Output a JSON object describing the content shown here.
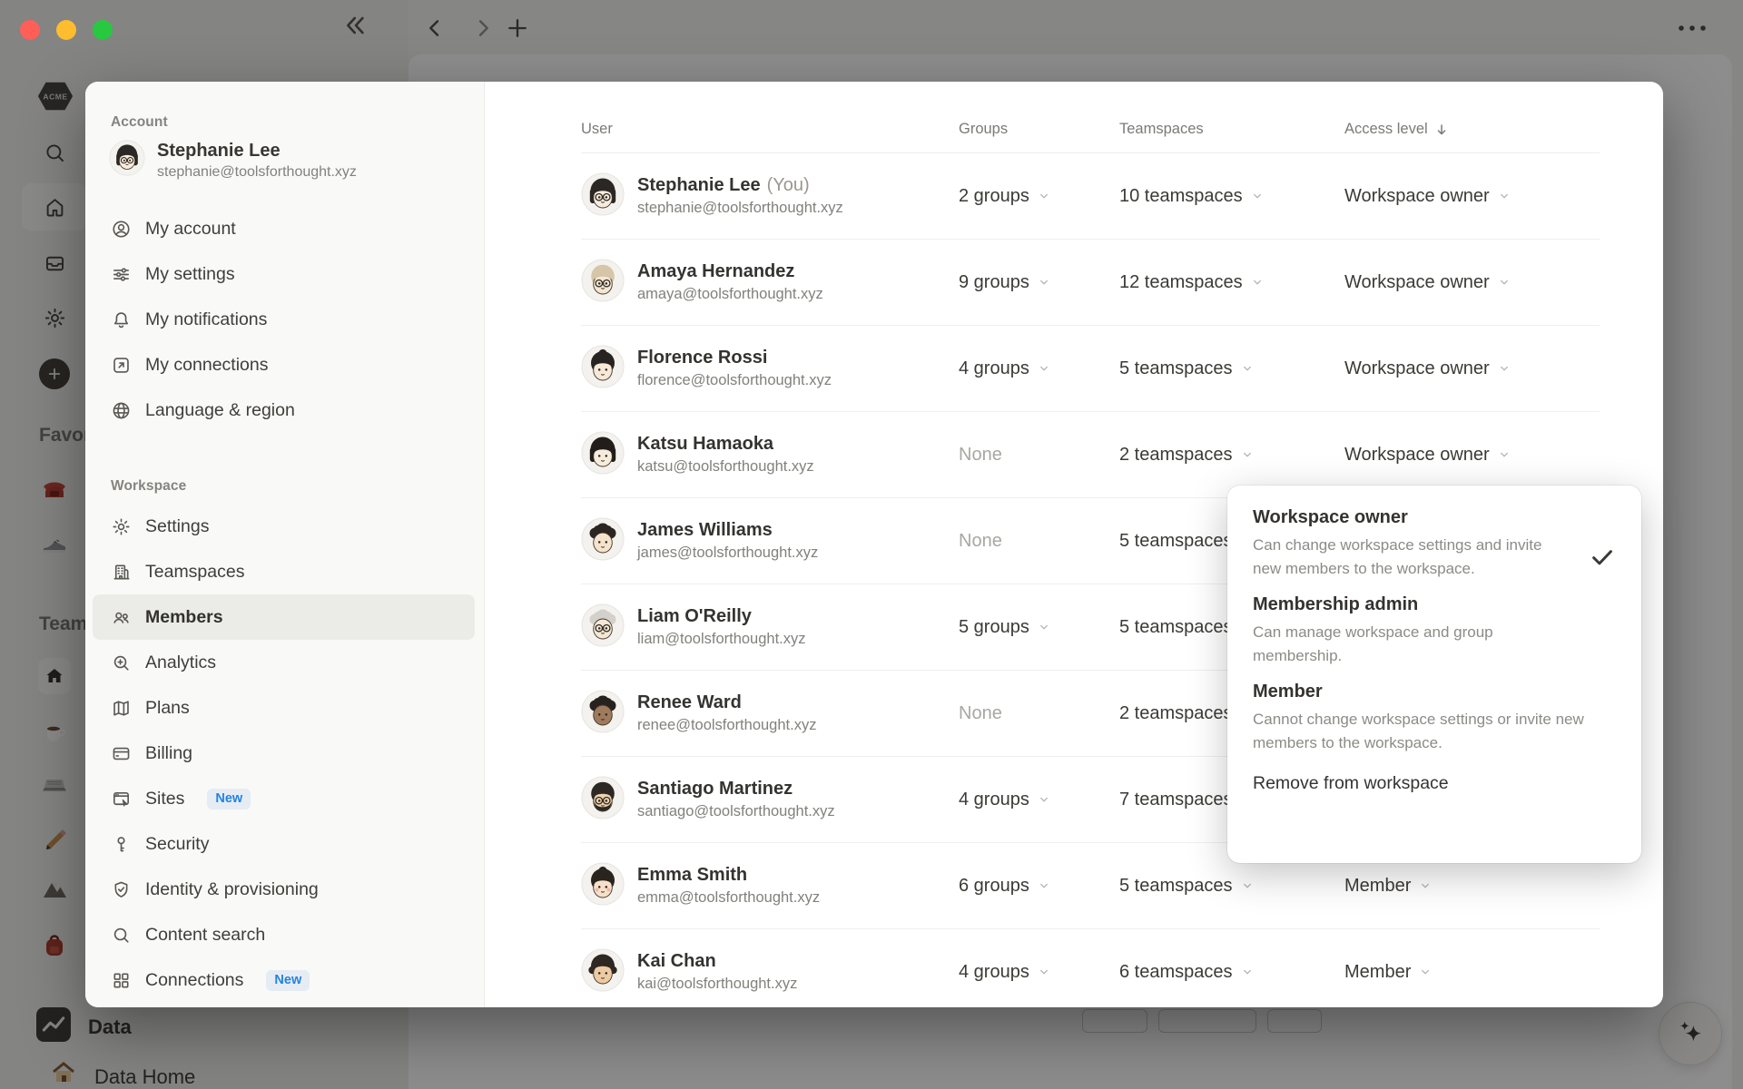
{
  "window": {
    "traffic_lights": {
      "close": "#ff5f57",
      "minimize": "#febc2e",
      "zoom": "#28c840"
    },
    "topbar_icons": [
      "collapse-sidebar",
      "back",
      "forward",
      "new-tab",
      "more"
    ]
  },
  "background_sidebar": {
    "logo_text": "ACME",
    "nav_icons": [
      "search",
      "home",
      "inbox",
      "gear",
      "plus-circle"
    ],
    "favorites_label": "Favorites",
    "favorites_items": [
      "telephone",
      "sneaker"
    ],
    "teamspaces_label": "Teamspaces",
    "teamspaces_items": [
      "home-tile",
      "coffee",
      "laptop",
      "pencil",
      "mountain",
      "backpack"
    ],
    "data_label": "Data",
    "data_home_label": "Data Home"
  },
  "settings_modal": {
    "account": {
      "heading": "Account",
      "user": {
        "name": "Stephanie Lee",
        "email": "stephanie@toolsforthought.xyz",
        "avatar": {
          "hair": "bob",
          "hair_color": "#2a2724",
          "skin": "#f7ebdb",
          "glasses": true
        }
      },
      "items": [
        {
          "label": "My account",
          "icon": "person-circle"
        },
        {
          "label": "My settings",
          "icon": "sliders"
        },
        {
          "label": "My notifications",
          "icon": "bell"
        },
        {
          "label": "My connections",
          "icon": "arrow-square"
        },
        {
          "label": "Language & region",
          "icon": "globe"
        }
      ]
    },
    "workspace": {
      "heading": "Workspace",
      "items": [
        {
          "label": "Settings",
          "icon": "gear"
        },
        {
          "label": "Teamspaces",
          "icon": "building"
        },
        {
          "label": "Members",
          "icon": "people",
          "selected": true
        },
        {
          "label": "Analytics",
          "icon": "magnifier-plus"
        },
        {
          "label": "Plans",
          "icon": "map"
        },
        {
          "label": "Billing",
          "icon": "credit-card"
        },
        {
          "label": "Sites",
          "icon": "browser-cursor",
          "badge": "New"
        },
        {
          "label": "Security",
          "icon": "key"
        },
        {
          "label": "Identity & provisioning",
          "icon": "shield-check"
        },
        {
          "label": "Content search",
          "icon": "magnifier"
        },
        {
          "label": "Connections",
          "icon": "grid",
          "badge": "New"
        }
      ]
    },
    "members_table": {
      "columns": [
        "User",
        "Groups",
        "Teamspaces",
        "Access level"
      ],
      "sorted_column": "Access level",
      "sort_direction": "desc",
      "rows": [
        {
          "name": "Stephanie Lee",
          "name_suffix": "(You)",
          "email": "stephanie@toolsforthought.xyz",
          "groups": "2 groups",
          "teamspaces": "10 teamspaces",
          "access": "Workspace owner",
          "avatar": {
            "hair": "bob",
            "hair_color": "#2a2724",
            "skin": "#f7ebdb",
            "glasses": true
          }
        },
        {
          "name": "Amaya Hernandez",
          "name_suffix": "",
          "email": "amaya@toolsforthought.xyz",
          "groups": "9 groups",
          "teamspaces": "12 teamspaces",
          "access": "Workspace owner",
          "avatar": {
            "hair": "short",
            "hair_color": "#d6c5a8",
            "skin": "#f5e6d2",
            "glasses": true
          }
        },
        {
          "name": "Florence Rossi",
          "name_suffix": "",
          "email": "florence@toolsforthought.xyz",
          "groups": "4 groups",
          "teamspaces": "5 teamspaces",
          "access": "Workspace owner",
          "avatar": {
            "hair": "bun",
            "hair_color": "#262320",
            "skin": "#f7e9d6"
          }
        },
        {
          "name": "Katsu Hamaoka",
          "name_suffix": "",
          "email": "katsu@toolsforthought.xyz",
          "groups": "None",
          "teamspaces": "2 teamspaces",
          "access": "Workspace owner",
          "avatar": {
            "hair": "bob",
            "hair_color": "#201d1b",
            "skin": "#f7ecdb"
          }
        },
        {
          "name": "James Williams",
          "name_suffix": "",
          "email": "james@toolsforthought.xyz",
          "groups": "None",
          "teamspaces": "5 teamspaces",
          "access": "",
          "avatar": {
            "hair": "curly",
            "hair_color": "#2b2622",
            "skin": "#f6e3cb"
          }
        },
        {
          "name": "Liam O'Reilly",
          "name_suffix": "",
          "email": "liam@toolsforthought.xyz",
          "groups": "5 groups",
          "teamspaces": "5 teamspaces",
          "access": "",
          "avatar": {
            "hair": "curly",
            "hair_color": "#d3d1cb",
            "skin": "#f5e7d3",
            "glasses": true
          }
        },
        {
          "name": "Renee Ward",
          "name_suffix": "",
          "email": "renee@toolsforthought.xyz",
          "groups": "None",
          "teamspaces": "2 teamspaces",
          "access": "",
          "avatar": {
            "hair": "curly",
            "hair_color": "#272220",
            "skin": "#a07a5c"
          }
        },
        {
          "name": "Santiago Martinez",
          "name_suffix": "",
          "email": "santiago@toolsforthought.xyz",
          "groups": "4 groups",
          "teamspaces": "7 teamspaces",
          "access": "",
          "avatar": {
            "hair": "short",
            "hair_color": "#2d2823",
            "skin": "#edd2ae",
            "glasses": true,
            "beard": true
          }
        },
        {
          "name": "Emma Smith",
          "name_suffix": "",
          "email": "emma@toolsforthought.xyz",
          "groups": "6 groups",
          "teamspaces": "5 teamspaces",
          "access": "Member",
          "avatar": {
            "hair": "bun",
            "hair_color": "#2a241e",
            "skin": "#f7e0c8",
            "blush": true
          }
        },
        {
          "name": "Kai Chan",
          "name_suffix": "",
          "email": "kai@toolsforthought.xyz",
          "groups": "4 groups",
          "teamspaces": "6 teamspaces",
          "access": "Member",
          "avatar": {
            "hair": "waves",
            "hair_color": "#2e2722",
            "skin": "#eccaa2"
          }
        }
      ]
    }
  },
  "access_level_menu": {
    "options": [
      {
        "label": "Workspace owner",
        "description": "Can change workspace settings and invite new members to the workspace.",
        "selected": true
      },
      {
        "label": "Membership admin",
        "description": "Can manage workspace and group membership.",
        "selected": false
      },
      {
        "label": "Member",
        "description": "Cannot change workspace settings or invite new members to the workspace.",
        "selected": false
      }
    ],
    "remove_label": "Remove from workspace"
  },
  "colors": {
    "accent_blue": "#2383e2",
    "traffic_red": "#ff5f57",
    "traffic_yellow": "#febc2e",
    "traffic_green": "#28c840"
  }
}
